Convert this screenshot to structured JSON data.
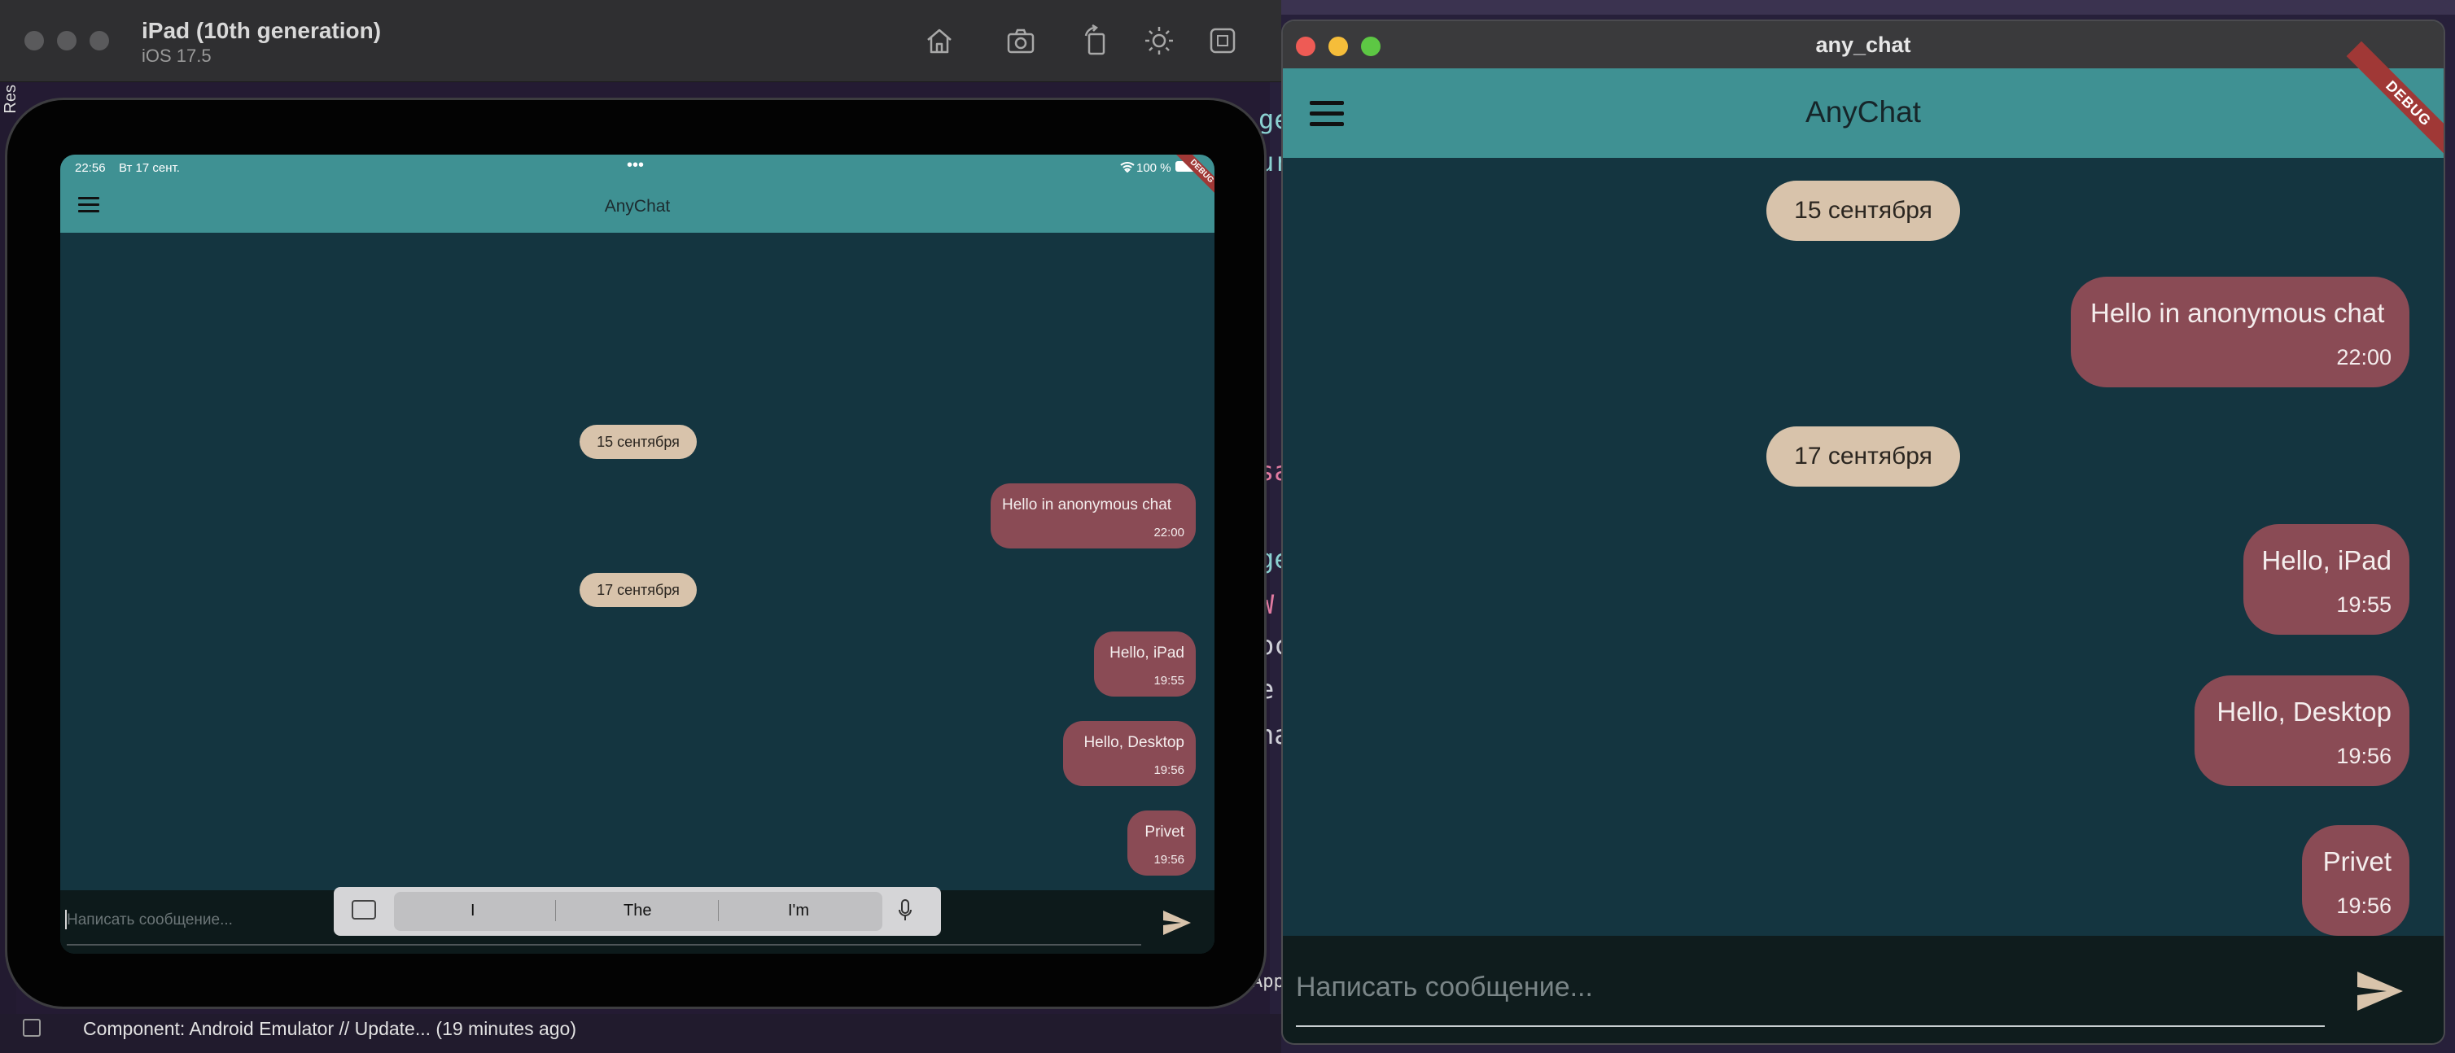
{
  "simulator": {
    "device_name": "iPad (10th generation)",
    "os_version": "iOS 17.5",
    "toolbar_icons": [
      "home-icon",
      "screenshot-icon",
      "rotate-icon",
      "appearance-icon",
      "keyboard-shortcut-icon"
    ]
  },
  "ipad": {
    "status": {
      "time": "22:56",
      "date": "Вт 17 сент.",
      "dots": "•••",
      "battery": "100 %"
    },
    "app_title": "AnyChat",
    "debug": "DEBUG",
    "input_placeholder": "Написать сообщение...",
    "keyboard_suggestions": [
      "I",
      "The",
      "I'm"
    ]
  },
  "desktop_window": {
    "title": "any_chat",
    "app_title": "AnyChat",
    "debug": "DEBUG",
    "input_placeholder": "Написать сообщение..."
  },
  "chat": {
    "date_1": "15 сентября",
    "date_2": "17 сентября",
    "messages": [
      {
        "text": "Hello in anonymous chat",
        "time": "22:00"
      },
      {
        "text": "Hello, iPad",
        "time": "19:55"
      },
      {
        "text": "Hello, Desktop",
        "time": "19:56"
      },
      {
        "text": "Privet",
        "time": "19:56"
      }
    ]
  },
  "bottom_status": {
    "text": "Component: Android Emulator // Update... (19 minutes ago)"
  },
  "ide_fragments": {
    "left_label": "Res",
    "frag_app": "App"
  },
  "colors": {
    "appbar": "#3f9193",
    "chat_background": "#143540",
    "bubble": "#8a4b55",
    "date_chip": "#d8c3ab",
    "input_bar": "#0f1c1d"
  }
}
